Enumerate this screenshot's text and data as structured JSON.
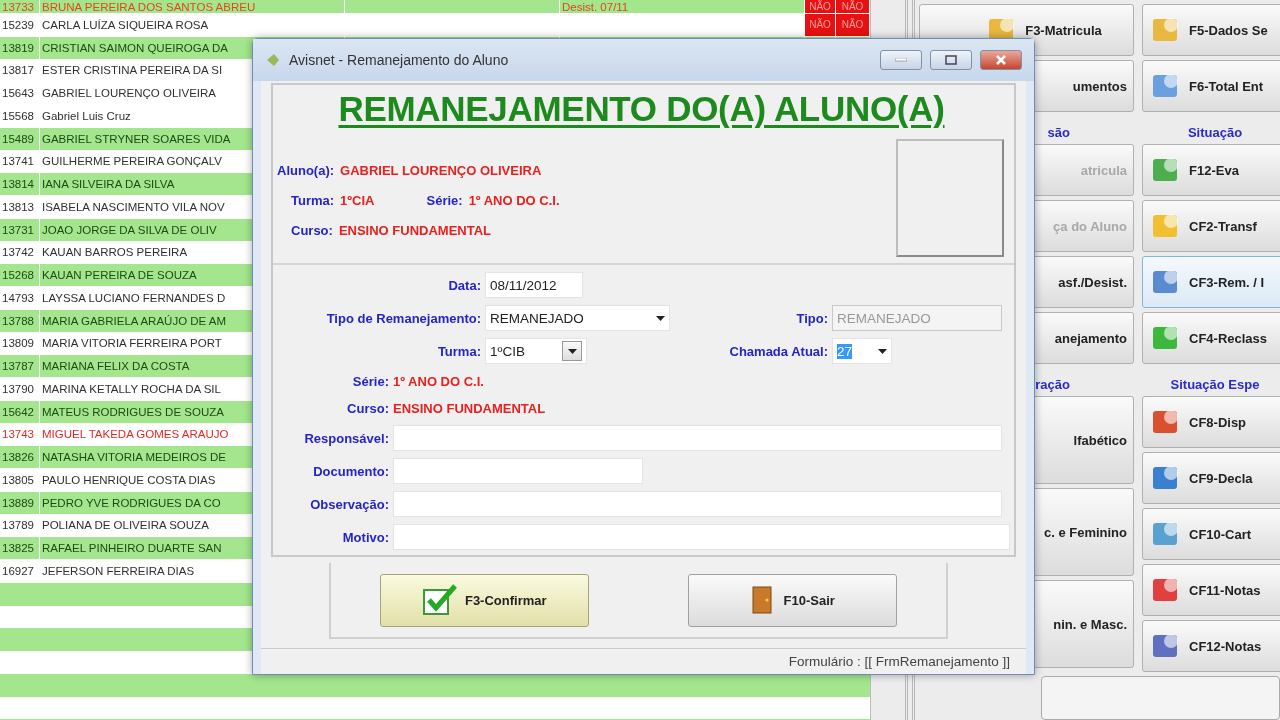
{
  "student_list": {
    "rows": [
      {
        "id": "13733",
        "name": "BRUNA PEREIRA DOS SANTOS ABREU",
        "highlighted": true,
        "kind": "withdrawn",
        "column_4": "Desist. 07/11",
        "flags": [
          "NÃO",
          "NÃO"
        ]
      },
      {
        "id": "15239",
        "name": "CARLA LUÍZA SIQUEIRA ROSA",
        "highlighted": false,
        "kind": "normal",
        "flags": [
          "NÃO",
          "NÃO"
        ]
      },
      {
        "id": "13819",
        "name": "CRISTIAN SAIMON QUEIROGA DA",
        "highlighted": true,
        "kind": "normal"
      },
      {
        "id": "13817",
        "name": "ESTER CRISTINA PEREIRA DA SI",
        "highlighted": false,
        "kind": "normal"
      },
      {
        "id": "15643",
        "name": "GABRIEL LOURENÇO OLIVEIRA",
        "highlighted": false,
        "kind": "normal"
      },
      {
        "id": "15568",
        "name": "Gabriel Luis Cruz",
        "highlighted": false,
        "kind": "normal"
      },
      {
        "id": "15489",
        "name": "GABRIEL STRYNER SOARES VIDA",
        "highlighted": true,
        "kind": "normal"
      },
      {
        "id": "13741",
        "name": "GUILHERME PEREIRA GONÇALV",
        "highlighted": false,
        "kind": "normal"
      },
      {
        "id": "13814",
        "name": "IANA SILVEIRA DA SILVA",
        "highlighted": true,
        "kind": "normal"
      },
      {
        "id": "13813",
        "name": "ISABELA NASCIMENTO VILA NOV",
        "highlighted": false,
        "kind": "normal"
      },
      {
        "id": "13731",
        "name": "JOAO JORGE DA SILVA DE OLIV",
        "highlighted": true,
        "kind": "normal"
      },
      {
        "id": "13742",
        "name": "KAUAN BARROS PEREIRA",
        "highlighted": false,
        "kind": "normal"
      },
      {
        "id": "15268",
        "name": "KAUAN PEREIRA DE SOUZA",
        "highlighted": true,
        "kind": "normal"
      },
      {
        "id": "14793",
        "name": "LAYSSA LUCIANO FERNANDES D",
        "highlighted": false,
        "kind": "normal"
      },
      {
        "id": "13788",
        "name": "MARIA GABRIELA ARAÚJO DE AM",
        "highlighted": true,
        "kind": "normal"
      },
      {
        "id": "13809",
        "name": "MARIA VITORIA FERREIRA PORT",
        "highlighted": false,
        "kind": "normal"
      },
      {
        "id": "13787",
        "name": "MARIANA FELIX DA COSTA",
        "highlighted": true,
        "kind": "normal"
      },
      {
        "id": "13790",
        "name": "MARINA KETALLY ROCHA DA SIL",
        "highlighted": false,
        "kind": "normal"
      },
      {
        "id": "15642",
        "name": "MATEUS RODRIGUES DE SOUZA",
        "highlighted": true,
        "kind": "normal"
      },
      {
        "id": "13743",
        "name": "MIGUEL TAKEDA GOMES ARAUJO",
        "highlighted": false,
        "kind": "alert"
      },
      {
        "id": "13826",
        "name": "NATASHA VITORIA MEDEIROS DE",
        "highlighted": true,
        "kind": "normal"
      },
      {
        "id": "13805",
        "name": "PAULO HENRIQUE COSTA DIAS",
        "highlighted": false,
        "kind": "normal"
      },
      {
        "id": "13889",
        "name": "PEDRO YVE RODRIGUES DA CO",
        "highlighted": true,
        "kind": "normal"
      },
      {
        "id": "13789",
        "name": "POLIANA DE OLIVEIRA SOUZA",
        "highlighted": false,
        "kind": "normal"
      },
      {
        "id": "13825",
        "name": "RAFAEL PINHEIRO DUARTE SAN",
        "highlighted": true,
        "kind": "normal"
      },
      {
        "id": "16927",
        "name": "JEFERSON FERREIRA DIAS",
        "highlighted": false,
        "kind": "normal"
      }
    ]
  },
  "side_panel": {
    "columns": [
      {
        "items": [
          {
            "kind": "button",
            "label": "F3-Matricula",
            "disabled": false,
            "selected": false
          },
          {
            "kind": "button",
            "label": "umentos",
            "disabled": false,
            "selected": false
          },
          {
            "kind": "heading",
            "label": "são"
          },
          {
            "kind": "button",
            "label": "atricula",
            "disabled": true,
            "selected": false
          },
          {
            "kind": "button",
            "label": "ça do Aluno",
            "disabled": true,
            "selected": false
          },
          {
            "kind": "button",
            "label": "asf./Desist.",
            "disabled": false,
            "selected": false
          },
          {
            "kind": "button",
            "label": "anejamento",
            "disabled": false,
            "selected": false
          },
          {
            "kind": "heading",
            "label": "ração"
          },
          {
            "kind": "tall",
            "label": "lfabético",
            "disabled": false,
            "selected": false
          },
          {
            "kind": "tall",
            "label": "c. e Feminino",
            "disabled": false,
            "selected": false
          },
          {
            "kind": "tall",
            "label": "nin. e Masc.",
            "disabled": false,
            "selected": false
          }
        ]
      },
      {
        "items": [
          {
            "kind": "button",
            "label": "F5-Dados Se",
            "disabled": false,
            "selected": false
          },
          {
            "kind": "button",
            "label": "F6-Total Ent",
            "disabled": false,
            "selected": false
          },
          {
            "kind": "heading",
            "label": "Situação"
          },
          {
            "kind": "button",
            "label": "F12-Eva",
            "disabled": false,
            "selected": false
          },
          {
            "kind": "button",
            "label": "CF2-Transf",
            "disabled": false,
            "selected": false
          },
          {
            "kind": "button",
            "label": "CF3-Rem. / I",
            "disabled": false,
            "selected": true
          },
          {
            "kind": "button",
            "label": "CF4-Reclass",
            "disabled": false,
            "selected": false
          },
          {
            "kind": "heading",
            "label": "Situação Espe"
          },
          {
            "kind": "button",
            "label": "CF8-Disp",
            "disabled": false,
            "selected": false
          },
          {
            "kind": "button",
            "label": "CF9-Decla",
            "disabled": false,
            "selected": false
          },
          {
            "kind": "button",
            "label": "CF10-Cart",
            "disabled": false,
            "selected": false
          },
          {
            "kind": "button",
            "label": "CF11-Notas",
            "disabled": false,
            "selected": false
          },
          {
            "kind": "button",
            "label": "CF12-Notas",
            "disabled": false,
            "selected": false
          }
        ]
      }
    ]
  },
  "dialog": {
    "title": "Avisnet - Remanejamento do Aluno",
    "header": {
      "title": "REMANEJAMENTO DO(A) ALUNO(A)",
      "student": {
        "label": "Aluno(a):",
        "value": "GABRIEL LOURENÇO OLIVEIRA"
      },
      "class": {
        "label": "Turma:",
        "value": "1ºCIA"
      },
      "grade": {
        "label": "Série:",
        "value": "1º ANO DO C.I."
      },
      "course": {
        "label": "Curso:",
        "value": "ENSINO FUNDAMENTAL"
      }
    },
    "form": {
      "date": {
        "label": "Data:",
        "value": "08/11/2012"
      },
      "transfer_type": {
        "label": "Tipo de Remanejamento:",
        "value": "REMANEJADO"
      },
      "type": {
        "label": "Tipo:",
        "value": "REMANEJADO",
        "disabled": true
      },
      "class": {
        "label": "Turma:",
        "value": "1ºCIB"
      },
      "current_call": {
        "label": "Chamada Atual:",
        "value": "27",
        "highlighted": true
      },
      "grade": {
        "label": "Série:",
        "value": "1º ANO DO C.I."
      },
      "course": {
        "label": "Curso:",
        "value": "ENSINO FUNDAMENTAL"
      },
      "responsible": {
        "label": "Responsável:"
      },
      "document": {
        "label": "Documento:"
      },
      "observation": {
        "label": "Observação:"
      },
      "reason": {
        "label": "Motivo:"
      }
    },
    "buttons": [
      {
        "kind": "confirm",
        "label": "F3-Confirmar"
      },
      {
        "kind": "exit",
        "label": "F10-Sair"
      }
    ],
    "status_bar": "Formulário : [[ FrmRemanejamento ]]"
  }
}
